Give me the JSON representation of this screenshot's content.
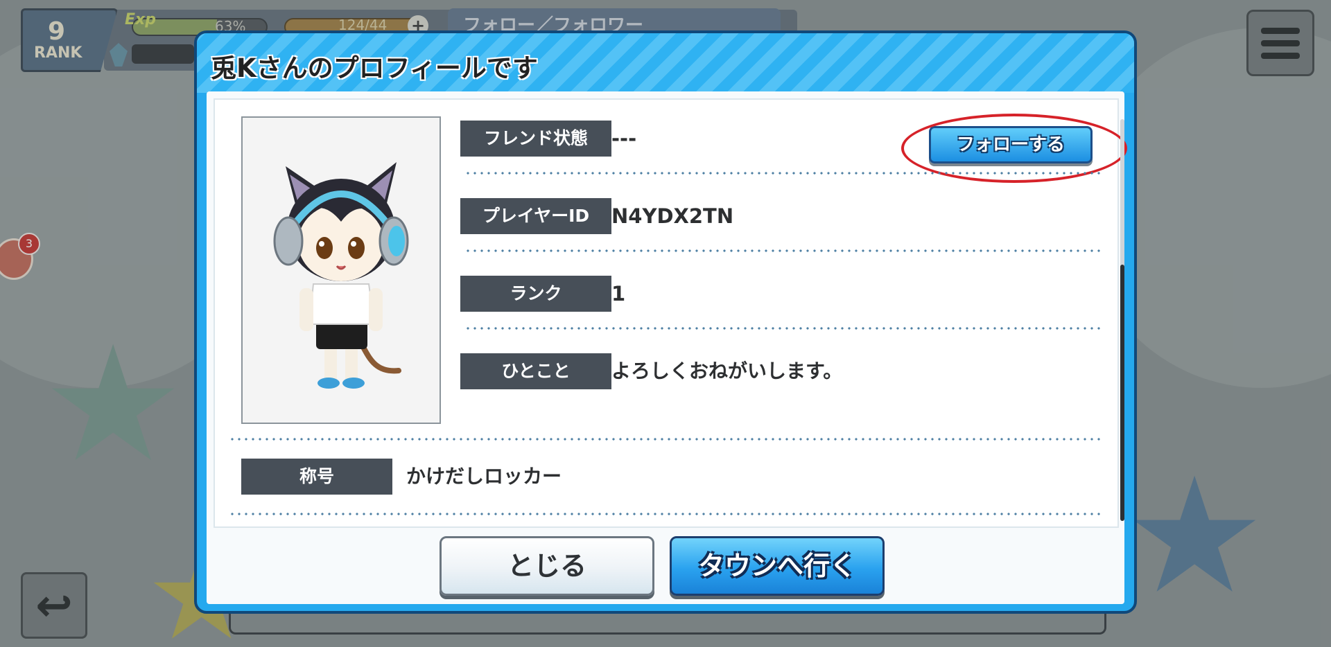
{
  "hud": {
    "rank_number": "9",
    "rank_label": "RANK",
    "exp_label": "Exp",
    "exp_percent": "63%",
    "exp_fraction": 0.63,
    "stamina_text": "124/44",
    "plus_symbol": "+",
    "tab_label": "フォロー／フォロワー",
    "notification_count": "3"
  },
  "dialog": {
    "title": "兎Kさんのプロフィールです",
    "fields": {
      "friend_status": {
        "label": "フレンド状態",
        "value": "---"
      },
      "player_id": {
        "label": "プレイヤーID",
        "value": "N4YDX2TN"
      },
      "rank": {
        "label": "ランク",
        "value": "1"
      },
      "comment": {
        "label": "ひとこと",
        "value": "よろしくおねがいします。"
      },
      "title": {
        "label": "称号",
        "value": "かけだしロッカー"
      }
    },
    "follow_button": "フォローする",
    "close_button": "とじる",
    "town_button": "タウンへ行く"
  },
  "colors": {
    "dialog_accent": "#25a9ee",
    "label_bg": "#474f58",
    "highlight": "#d62229"
  },
  "icons": [
    "menu-icon",
    "back-arrow-icon",
    "gem-icon",
    "plus-icon",
    "character-portrait"
  ]
}
